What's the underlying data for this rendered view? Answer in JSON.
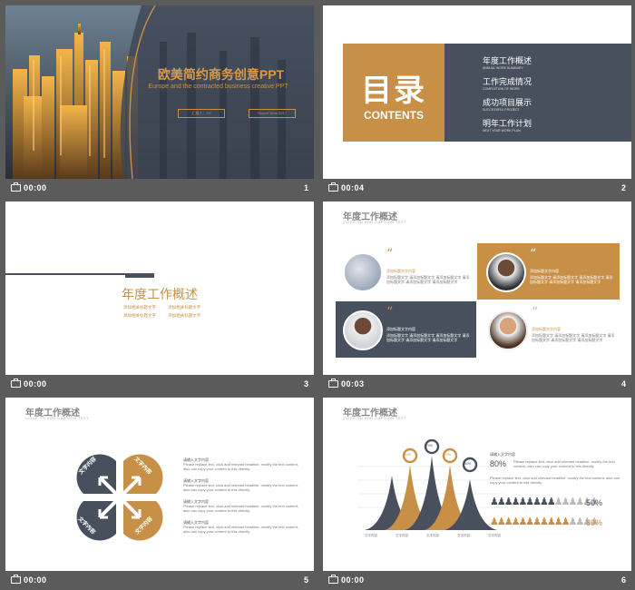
{
  "slides": [
    {
      "time": "00:00",
      "number": "1",
      "title": "欧美简约商务创意PPT",
      "subtitle": "Europe and the contracted business creative PPT",
      "tag1": "汇报人：XX",
      "tag2": "Report Time:2017"
    },
    {
      "time": "00:04",
      "number": "2",
      "toc_title": "目录",
      "toc_en": "CONTENTS",
      "items": [
        {
          "cn": "年度工作概述",
          "en": "ANNUAL WORK SUMMARY"
        },
        {
          "cn": "工作完成情况",
          "en": "COMPLETION OF WORK"
        },
        {
          "cn": "成功项目展示",
          "en": "SUCCESSFUL PROJECT"
        },
        {
          "cn": "明年工作计划",
          "en": "NEXT YEAR WORK PLAN"
        }
      ]
    },
    {
      "time": "00:00",
      "number": "3",
      "title": "年度工作概述",
      "bullets": [
        "添加相关标题文字",
        "添加相关标题文字",
        "添加相关标题文字",
        "添加相关标题文字"
      ]
    },
    {
      "time": "00:03",
      "number": "4",
      "title": "年度工作概述",
      "caption": "CLICK TO ADD CAPTION TEXT",
      "card_title": "添加标题文字内容",
      "card_text": "添加标题文字 请添加标题文字 请添加标题文字 请添加标题文字 请添加标题文字 请添加标题文字"
    },
    {
      "time": "00:00",
      "number": "5",
      "title": "年度工作概述",
      "caption": "CLICK TO ADD CAPTION TEXT",
      "petals": [
        "文字内容",
        "文字内容",
        "文字内容",
        "文字内容"
      ],
      "item_title": "请输入文字内容",
      "item_text": "Please replace text, click add relevant headline, modify the text content, also can copy your content to this directly."
    },
    {
      "time": "00:00",
      "number": "6",
      "title": "年度工作概述",
      "caption": "CLICK TO ADD CAPTION TEXT",
      "peaks": [
        "60%",
        "70%",
        "70%",
        "60%"
      ],
      "labels": [
        "文字内容",
        "文字内容",
        "文字内容",
        "文字内容",
        "文字内容"
      ],
      "stat1": "80%",
      "stat2": "50%",
      "stat3": "80%",
      "head": "请输入文字内容",
      "text": "Please replace text, click add relevant headline, modify the text content, also can copy your content to this directly."
    }
  ],
  "colors": {
    "gold": "#c88f47",
    "navy": "#48505e",
    "frame": "#5b5b5b"
  }
}
